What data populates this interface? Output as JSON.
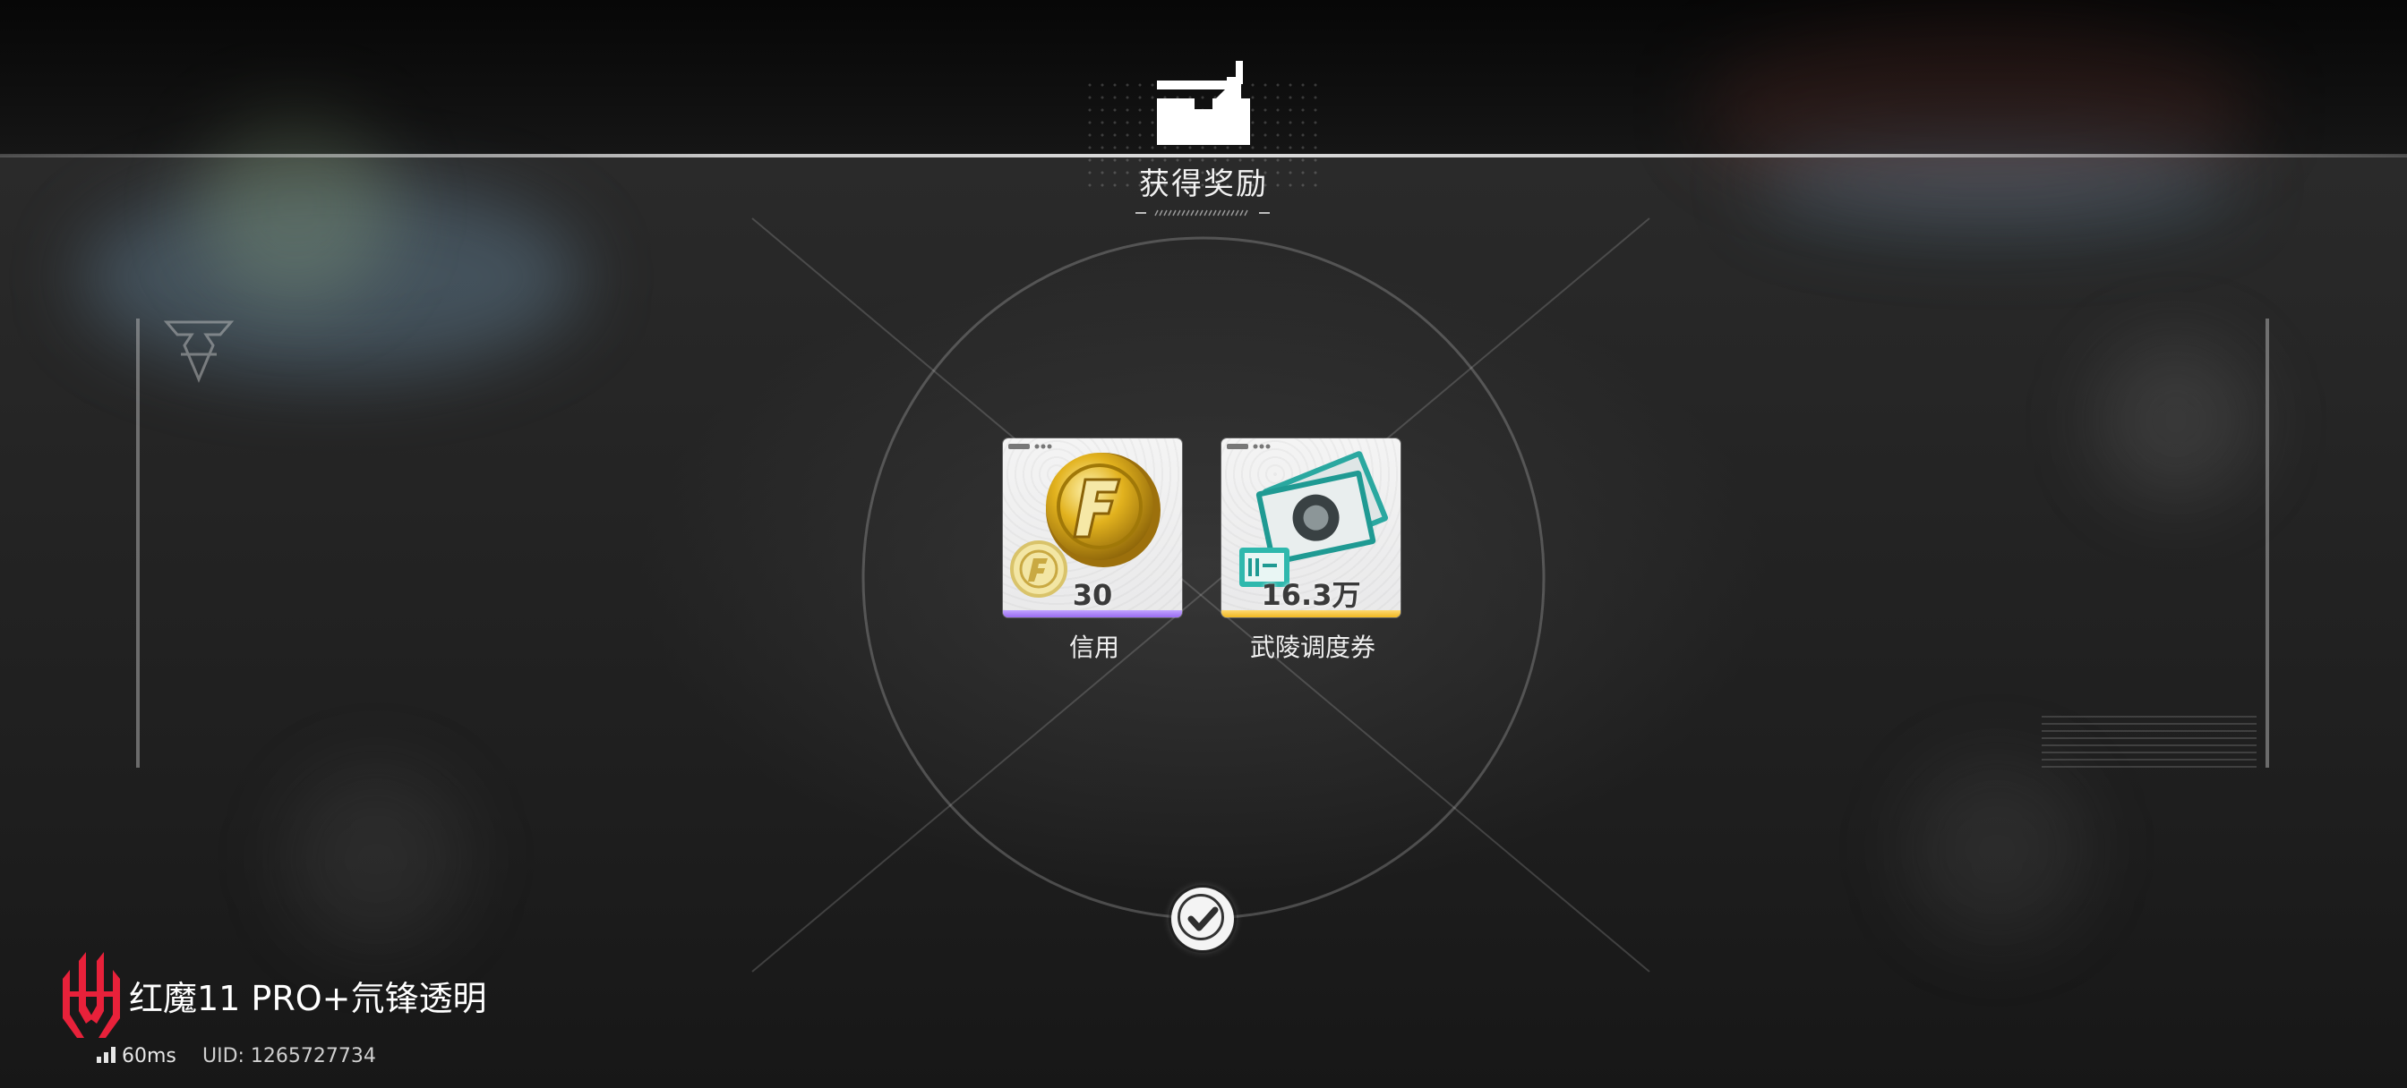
{
  "dialog": {
    "title": "获得奖励"
  },
  "rewards": [
    {
      "name": "信用",
      "quantity": "30",
      "rarity_color": "#9a6cf0",
      "icon": "credit-coin-icon"
    },
    {
      "name": "武陵调度券",
      "quantity": "16.3万",
      "rarity_color": "#f0b822",
      "icon": "wuling-dispatch-ticket-icon"
    }
  ],
  "confirm": {
    "icon": "check-icon"
  },
  "overlay": {
    "brand": "红魔11 PRO+氘锋透明",
    "ping": "60ms",
    "uid": "UID: 1265727734",
    "brand_color": "#e8213a"
  }
}
